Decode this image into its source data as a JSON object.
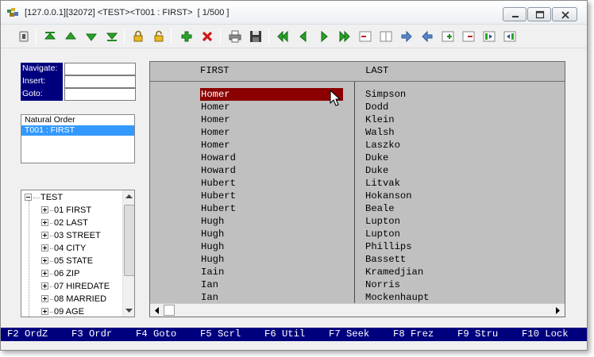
{
  "window": {
    "title": "[127.0.0.1][32072] <TEST><T001 : FIRST>  [ 1/500 ]"
  },
  "toolbar": {
    "buttons": [
      "info-icon",
      "first-record-icon",
      "prev-record-icon",
      "next-record-icon",
      "last-record-icon",
      "lock-icon",
      "unlock-icon",
      "add-icon",
      "delete-icon",
      "print-icon",
      "save-icon",
      "first-page-icon",
      "prev-page-icon",
      "next-page-icon",
      "last-page-icon",
      "delete-column-icon",
      "insert-column-icon",
      "move-right-icon",
      "move-left-icon",
      "add-row-icon",
      "remove-row-icon",
      "freeze-right-icon",
      "freeze-left-icon"
    ]
  },
  "nav": {
    "navigate_label": "Navigate:",
    "insert_label": "Insert:",
    "goto_label": "Goto:",
    "navigate_value": "",
    "insert_value": "",
    "goto_value": ""
  },
  "orders": {
    "items": [
      "Natural Order",
      "T001 : FIRST"
    ],
    "selected": 1
  },
  "tree": {
    "root": "TEST",
    "fields": [
      "01 FIRST",
      "02 LAST",
      "03 STREET",
      "04 CITY",
      "05 STATE",
      "06 ZIP",
      "07 HIREDATE",
      "08 MARRIED",
      "09 AGE"
    ]
  },
  "grid": {
    "columns": [
      "FIRST",
      "LAST"
    ],
    "rows": [
      [
        "Homer",
        "Simpson"
      ],
      [
        "Homer",
        "Dodd"
      ],
      [
        "Homer",
        "Klein"
      ],
      [
        "Homer",
        "Walsh"
      ],
      [
        "Homer",
        "Laszko"
      ],
      [
        "Howard",
        "Duke"
      ],
      [
        "Howard",
        "Duke"
      ],
      [
        "Hubert",
        "Litvak"
      ],
      [
        "Hubert",
        "Hokanson"
      ],
      [
        "Hubert",
        "Beale"
      ],
      [
        "Hugh",
        "Lupton"
      ],
      [
        "Hugh",
        "Lupton"
      ],
      [
        "Hugh",
        "Phillips"
      ],
      [
        "Hugh",
        "Bassett"
      ],
      [
        "Iain",
        "Kramedjian"
      ],
      [
        "Ian",
        "Norris"
      ],
      [
        "Ian",
        "Mockenhaupt"
      ]
    ],
    "active_row": 0
  },
  "status": {
    "keys": [
      "F2 OrdZ",
      "F3 Ordr",
      "F4 Goto",
      "F5 Scrl",
      "F6 Util",
      "F7 Seek",
      "F8 Frez",
      "F9 Stru",
      "F10 Lock"
    ]
  },
  "colors": {
    "status_bg": "#00007f",
    "active_cell": "#8b0000",
    "selection": "#3399ff",
    "grid_bg": "#c0c0c0"
  }
}
